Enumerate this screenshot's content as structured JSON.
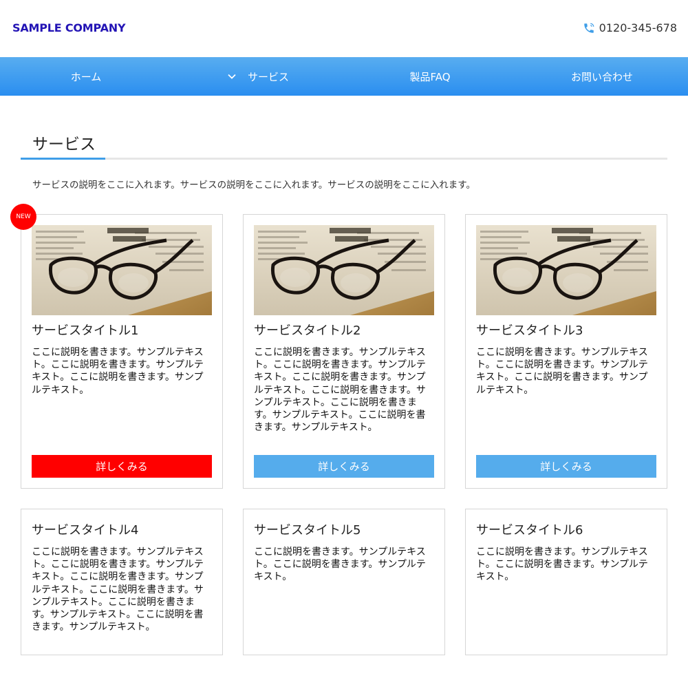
{
  "colors": {
    "brand": "#2314b5",
    "nav_top": "#58adf0",
    "nav_bottom": "#2a8ef0",
    "accent": "#3f9ee8",
    "button_default": "#55acec",
    "button_new": "#ff0000",
    "badge": "#ff0000"
  },
  "header": {
    "logo": "SAMPLE COMPANY",
    "phone": "0120-345-678",
    "phone_icon": "phone-icon"
  },
  "nav": {
    "items": [
      {
        "label": "ホーム"
      },
      {
        "label": "サービス",
        "icon": "chevron-down-icon"
      },
      {
        "label": "製品FAQ"
      },
      {
        "label": "お問い合わせ"
      }
    ]
  },
  "section": {
    "title": "サービス",
    "description": "サービスの説明をここに入れます。サービスの説明をここに入れます。サービスの説明をここに入れます。"
  },
  "badge": {
    "label": "NEW"
  },
  "cards": [
    {
      "title": "サービスタイトル1",
      "text": "ここに説明を書きます。サンプルテキスト。ここに説明を書きます。サンプルテキスト。ここに説明を書きます。サンプルテキスト。",
      "button": "詳しくみる"
    },
    {
      "title": "サービスタイトル2",
      "text": "ここに説明を書きます。サンプルテキスト。ここに説明を書きます。サンプルテキスト。ここに説明を書きます。サンプルテキスト。ここに説明を書きます。サンプルテキスト。ここに説明を書きます。サンプルテキスト。ここに説明を書きます。サンプルテキスト。",
      "button": "詳しくみる"
    },
    {
      "title": "サービスタイトル3",
      "text": "ここに説明を書きます。サンプルテキスト。ここに説明を書きます。サンプルテキスト。ここに説明を書きます。サンプルテキスト。",
      "button": "詳しくみる"
    },
    {
      "title": "サービスタイトル4",
      "text": "ここに説明を書きます。サンプルテキスト。ここに説明を書きます。サンプルテキスト。ここに説明を書きます。サンプルテキスト。ここに説明を書きます。サンプルテキスト。ここに説明を書きます。サンプルテキスト。ここに説明を書きます。サンプルテキスト。"
    },
    {
      "title": "サービスタイトル5",
      "text": "ここに説明を書きます。サンプルテキスト。ここに説明を書きます。サンプルテキスト。"
    },
    {
      "title": "サービスタイトル6",
      "text": "ここに説明を書きます。サンプルテキスト。ここに説明を書きます。サンプルテキスト。"
    }
  ]
}
